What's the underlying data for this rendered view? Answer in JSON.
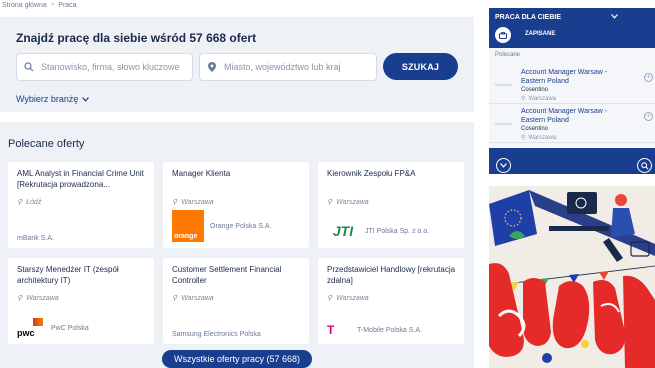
{
  "breadcrumb": {
    "home": "Strona główna",
    "current": "Praca"
  },
  "search": {
    "title": "Znajdź pracę dla siebie wśród 57 668 ofert",
    "keyword_placeholder": "Stanowisko, firma, słowo kluczowe",
    "location_placeholder": "Miasto, województwo lub kraj",
    "button": "SZUKAJ",
    "industry": "Wybierz branżę"
  },
  "offers": {
    "title": "Polecane oferty",
    "cards": [
      {
        "title": "AML Analyst in Financial Crime Unit [Rekrutacja prowadzona...",
        "location": "Łódź",
        "company": "mBank S.A.",
        "logo": "none"
      },
      {
        "title": "Manager Klienta",
        "location": "Warszawa",
        "company": "Orange Polska S.A.",
        "logo": "orange"
      },
      {
        "title": "Kierownik Zespołu FP&A",
        "location": "Warszawa",
        "company": "JTI Polska Sp. z o.o.",
        "logo": "jti"
      },
      {
        "title": "Starszy Menedżer IT (zespół architektury IT)",
        "location": "Warszawa",
        "company": "PwC Polska",
        "logo": "pwc"
      },
      {
        "title": "Customer Settlement Financial Controller",
        "location": "Warszawa",
        "company": "Samsung Electronics Polska",
        "logo": "none"
      },
      {
        "title": "Przedstawiciel Handlowy [rekrutacja zdalna]",
        "location": "Warszawa",
        "company": "T-Mobile Polska S.A.",
        "logo": "tmobile"
      }
    ],
    "all_button": "Wszystkie oferty pracy (57 668)"
  },
  "panel": {
    "title": "PRACA DLA CIEBIE",
    "tab_saved": "ZAPISANE",
    "section": "Polecane",
    "items": [
      {
        "title": "Account Manager Warsaw - Eastern Poland",
        "company": "Cosentino",
        "location": "Warszawa",
        "placeholder": "Cosentino"
      },
      {
        "title": "Account Manager Warsaw - Eastern Poland",
        "company": "Cosentino",
        "location": "Warszawa",
        "placeholder": "Cosentino"
      }
    ]
  },
  "logos": {
    "orange": "orange",
    "jti": "JTI",
    "pwc": "pwc",
    "tmobile": "T"
  },
  "colors": {
    "primary": "#1a3e8f",
    "panel_bg": "#eef2f7",
    "orange": "#ff7900",
    "tmobile": "#e20074",
    "jti_green": "#1d8a4a"
  }
}
